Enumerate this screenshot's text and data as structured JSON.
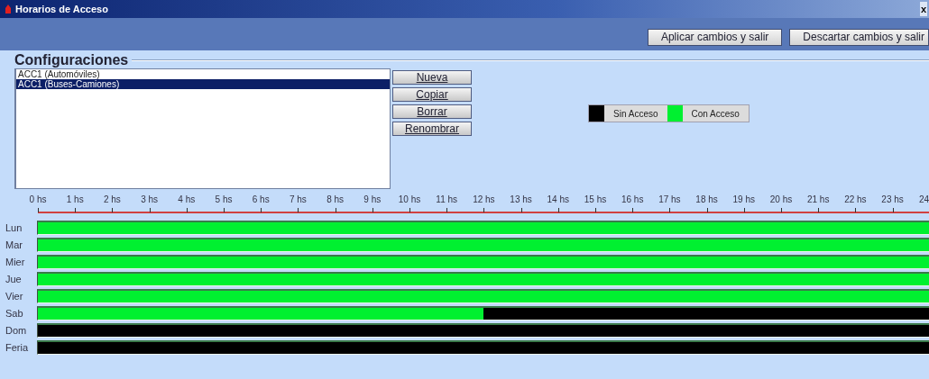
{
  "window": {
    "title": "Horarios de Acceso",
    "close": "x"
  },
  "actions": [
    "Aplicar cambios y salir",
    "Descartar cambios y salir"
  ],
  "configurations": {
    "title": "Configuraciones",
    "items": [
      {
        "label": "ACC1 (Automóviles)",
        "selected": false
      },
      {
        "label": "ACC1 (Buses-Camiones)",
        "selected": true
      }
    ],
    "buttons": [
      "Nueva",
      "Copiar",
      "Borrar",
      "Renombrar"
    ]
  },
  "legend": [
    {
      "label": "Sin Acceso",
      "color": "#000000"
    },
    {
      "label": "Con Acceso",
      "color": "#00f030"
    }
  ],
  "hour_labels": [
    "0 hs",
    "1 hs",
    "2 hs",
    "3 hs",
    "4 hs",
    "5 hs",
    "6 hs",
    "7 hs",
    "8 hs",
    "9 hs",
    "10 hs",
    "11 hs",
    "12 hs",
    "13 hs",
    "14 hs",
    "15 hs",
    "16 hs",
    "17 hs",
    "18 hs",
    "19 hs",
    "20 hs",
    "21 hs",
    "22 hs",
    "23 hs",
    "24"
  ],
  "days": [
    {
      "label": "Lun",
      "hours": [
        true,
        true,
        true,
        true,
        true,
        true,
        true,
        true,
        true,
        true,
        true,
        true,
        true,
        true,
        true,
        true,
        true,
        true,
        true,
        true,
        true,
        true,
        true,
        true
      ]
    },
    {
      "label": "Mar",
      "hours": [
        true,
        true,
        true,
        true,
        true,
        true,
        true,
        true,
        true,
        true,
        true,
        true,
        true,
        true,
        true,
        true,
        true,
        true,
        true,
        true,
        true,
        true,
        true,
        true
      ]
    },
    {
      "label": "Mier",
      "hours": [
        true,
        true,
        true,
        true,
        true,
        true,
        true,
        true,
        true,
        true,
        true,
        true,
        true,
        true,
        true,
        true,
        true,
        true,
        true,
        true,
        true,
        true,
        true,
        true
      ]
    },
    {
      "label": "Jue",
      "hours": [
        true,
        true,
        true,
        true,
        true,
        true,
        true,
        true,
        true,
        true,
        true,
        true,
        true,
        true,
        true,
        true,
        true,
        true,
        true,
        true,
        true,
        true,
        true,
        true
      ]
    },
    {
      "label": "Vier",
      "hours": [
        true,
        true,
        true,
        true,
        true,
        true,
        true,
        true,
        true,
        true,
        true,
        true,
        true,
        true,
        true,
        true,
        true,
        true,
        true,
        true,
        true,
        true,
        true,
        true
      ]
    },
    {
      "label": "Sab",
      "hours": [
        true,
        true,
        true,
        true,
        true,
        true,
        true,
        true,
        true,
        true,
        true,
        true,
        false,
        false,
        false,
        false,
        false,
        false,
        false,
        false,
        false,
        false,
        false,
        false
      ]
    },
    {
      "label": "Dom",
      "hours": [
        false,
        false,
        false,
        false,
        false,
        false,
        false,
        false,
        false,
        false,
        false,
        false,
        false,
        false,
        false,
        false,
        false,
        false,
        false,
        false,
        false,
        false,
        false,
        false
      ]
    },
    {
      "label": "Feria",
      "hours": [
        false,
        false,
        false,
        false,
        false,
        false,
        false,
        false,
        false,
        false,
        false,
        false,
        false,
        false,
        false,
        false,
        false,
        false,
        false,
        false,
        false,
        false,
        false,
        false
      ]
    }
  ]
}
